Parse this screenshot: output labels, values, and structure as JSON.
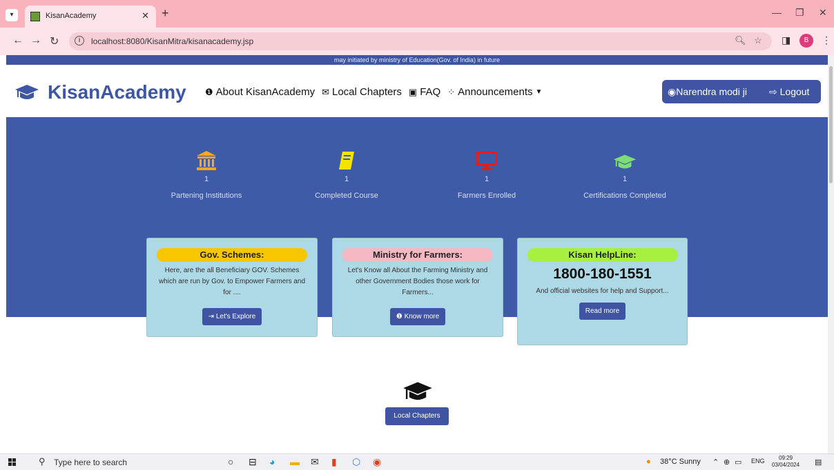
{
  "browser": {
    "tab_title": "KisanAcademy",
    "url": "localhost:8080/KisanMitra/kisanacademy.jsp",
    "profile_initial": "B"
  },
  "page": {
    "announcement": "may initiated by ministry of Education(Gov. of India) in future",
    "brand": "KisanAcademy",
    "nav": {
      "about": "About KisanAcademy",
      "chapters": "Local Chapters",
      "faq": "FAQ",
      "announcements": "Announcements"
    },
    "user_name": "Narendra modi ji",
    "logout": "Logout",
    "stats": [
      {
        "count": "1",
        "label": "Partening Institutions",
        "icon": "bank-icon",
        "color": "#f5a623"
      },
      {
        "count": "1",
        "label": "Completed Course",
        "icon": "book-icon",
        "color": "#f5e400"
      },
      {
        "count": "1",
        "label": "Farmers Enrolled",
        "icon": "desktop-icon",
        "color": "#e0201f"
      },
      {
        "count": "1",
        "label": "Certifications Completed",
        "icon": "graduation-cap-icon",
        "color": "#7cdd72"
      }
    ],
    "cards": [
      {
        "title": "Gov. Schemes:",
        "pill_color": "#f7c600",
        "text": "Here, are the all Beneficiary GOV. Schemes which are run by Gov. to Empower Farmers and for ....",
        "button": "Let's Explore"
      },
      {
        "title": "Ministry for Farmers:",
        "pill_color": "#f6b8c2",
        "text": "Let's Know all About the Farming Ministry and other Government Bodies those work for Farmers...",
        "button": "Know more"
      },
      {
        "title": "Kisan HelpLine:",
        "pill_color": "#a8f040",
        "phone": "1800-180-1551",
        "text": "And official websites for help and Support...",
        "button": "Read more"
      }
    ],
    "local_chapters_button": "Local Chapters"
  },
  "taskbar": {
    "search_placeholder": "Type here to search",
    "weather": "38°C  Sunny",
    "lang": "ENG",
    "time": "09:29",
    "date": "03/04/2024"
  }
}
